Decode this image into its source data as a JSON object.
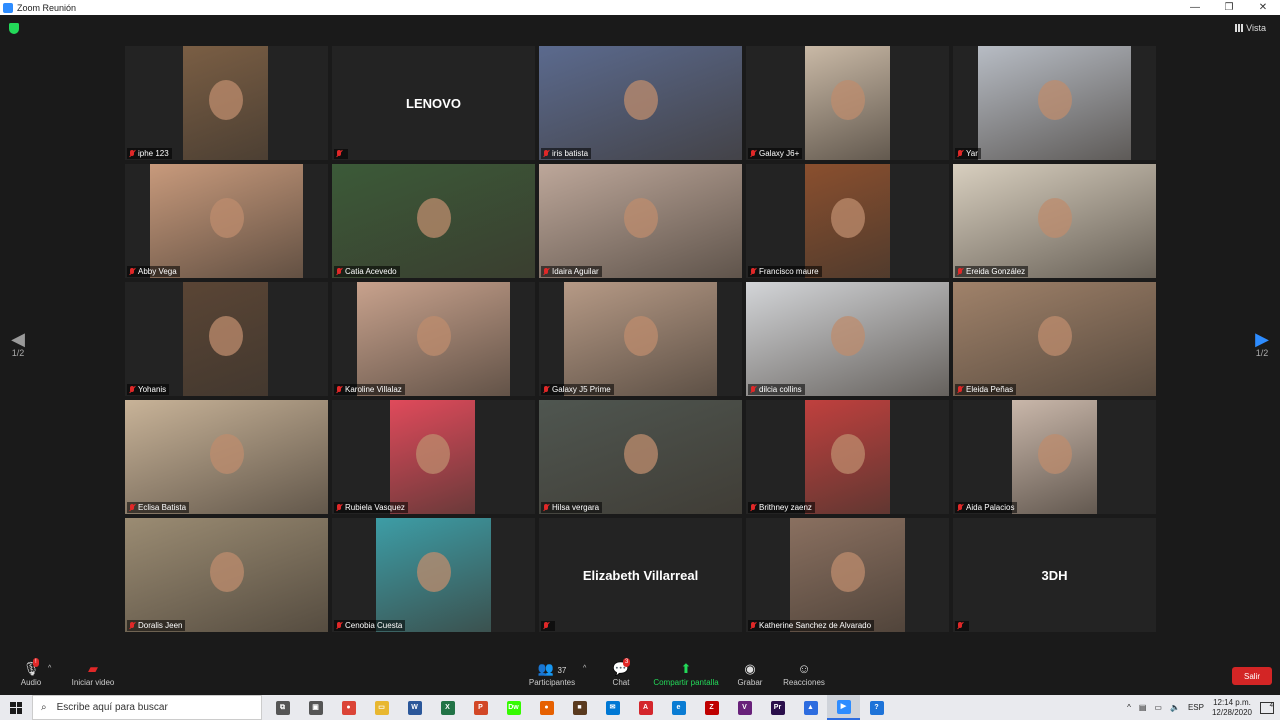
{
  "window": {
    "title": "Zoom Reunión",
    "controls": [
      "—",
      "❐",
      "✕"
    ]
  },
  "header": {
    "view_label": "Vista"
  },
  "pagination": {
    "left": "1/2",
    "right": "1/2"
  },
  "participants": [
    {
      "name": "iphe 123",
      "video": true,
      "bg": "#7a5e44",
      "w": 85,
      "x": 58
    },
    {
      "name": "",
      "video": false,
      "display_name": "LENOVO"
    },
    {
      "name": "iris batista",
      "video": true,
      "bg": "#5b6a8e",
      "w": 203,
      "x": 0
    },
    {
      "name": "Galaxy J6+",
      "video": true,
      "bg": "#c9b9a6",
      "w": 85,
      "x": 59
    },
    {
      "name": "Yar",
      "video": true,
      "bg": "#b7bcc4",
      "w": 153,
      "x": 25
    },
    {
      "name": "Abby Vega",
      "video": true,
      "bg": "#c89a7c",
      "w": 153,
      "x": 25
    },
    {
      "name": "Catia Acevedo",
      "video": true,
      "bg": "#3b5a38",
      "w": 203,
      "x": 0
    },
    {
      "name": "Idaira Aguilar",
      "video": true,
      "bg": "#bda79a",
      "w": 203,
      "x": 0
    },
    {
      "name": "Francisco maure",
      "video": true,
      "bg": "#8a4f2e",
      "w": 85,
      "x": 59
    },
    {
      "name": "Ereida González",
      "video": true,
      "bg": "#d8cfbf",
      "w": 203,
      "x": 0
    },
    {
      "name": "Yohanis",
      "video": true,
      "bg": "#5a4535",
      "w": 85,
      "x": 58
    },
    {
      "name": "Karoline Villalaz",
      "video": true,
      "bg": "#c8a28d",
      "w": 153,
      "x": 25
    },
    {
      "name": "Galaxy J5 Prime",
      "video": true,
      "bg": "#b69a86",
      "w": 153,
      "x": 25
    },
    {
      "name": "dilcia collins",
      "video": true,
      "bg": "#d3d5d8",
      "w": 203,
      "x": 0
    },
    {
      "name": "Eleida Peñas",
      "video": true,
      "bg": "#a0826a",
      "w": 203,
      "x": 0
    },
    {
      "name": "Eclisa Batista",
      "video": true,
      "bg": "#c8b398",
      "w": 203,
      "x": 0
    },
    {
      "name": "Rubiela Vasquez",
      "video": true,
      "bg": "#e04a5b",
      "w": 85,
      "x": 58
    },
    {
      "name": "Hilsa vergara",
      "video": true,
      "bg": "#4f5650",
      "w": 203,
      "x": 0
    },
    {
      "name": "Brithney zaenz",
      "video": true,
      "bg": "#c0403e",
      "w": 85,
      "x": 59
    },
    {
      "name": "Aida Palacios",
      "video": true,
      "bg": "#c9b7aa",
      "w": 85,
      "x": 59
    },
    {
      "name": "Doralis Jeen",
      "video": true,
      "bg": "#9b8c73",
      "w": 203,
      "x": 0
    },
    {
      "name": "Cenobia Cuesta",
      "video": true,
      "bg": "#3d9da6",
      "w": 115,
      "x": 44
    },
    {
      "name": "",
      "video": false,
      "display_name": "Elizabeth Villarreal"
    },
    {
      "name": "Katherine Sanchez de Alvarado",
      "video": true,
      "bg": "#8a7060",
      "w": 115,
      "x": 44
    },
    {
      "name": "",
      "video": false,
      "display_name": "3DH"
    }
  ],
  "toolbar": {
    "audio_label": "Audio",
    "audio_badge": "!",
    "video_label": "Iniciar video",
    "participants_label": "Participantes",
    "participants_count": "37",
    "chat_label": "Chat",
    "chat_badge": "3",
    "share_label": "Compartir pantalla",
    "record_label": "Grabar",
    "reactions_label": "Reacciones",
    "leave_label": "Salir"
  },
  "taskbar": {
    "search_placeholder": "Escribe aquí para buscar",
    "apps": [
      {
        "name": "task-view",
        "color": "#555555",
        "glyph": "⧉"
      },
      {
        "name": "store",
        "color": "#555555",
        "glyph": "▣"
      },
      {
        "name": "chrome",
        "color": "#db4437",
        "glyph": "●"
      },
      {
        "name": "file-explorer",
        "color": "#e8b730",
        "glyph": "▭"
      },
      {
        "name": "word",
        "color": "#2b579a",
        "glyph": "W"
      },
      {
        "name": "excel",
        "color": "#217346",
        "glyph": "X"
      },
      {
        "name": "powerpoint",
        "color": "#d24726",
        "glyph": "P"
      },
      {
        "name": "dreamweaver",
        "color": "#35fa00",
        "glyph": "Dw"
      },
      {
        "name": "firefox",
        "color": "#e66000",
        "glyph": "●"
      },
      {
        "name": "app-dark",
        "color": "#5a3a1e",
        "glyph": "■"
      },
      {
        "name": "mail",
        "color": "#0078d4",
        "glyph": "✉"
      },
      {
        "name": "acrobat",
        "color": "#d4262c",
        "glyph": "A"
      },
      {
        "name": "edge",
        "color": "#0a7cd3",
        "glyph": "e"
      },
      {
        "name": "filezilla",
        "color": "#bf0000",
        "glyph": "Z"
      },
      {
        "name": "visual-studio",
        "color": "#68217a",
        "glyph": "V"
      },
      {
        "name": "premiere",
        "color": "#2a0f4b",
        "glyph": "Pr"
      },
      {
        "name": "app-blue",
        "color": "#2d6cdf",
        "glyph": "▲"
      },
      {
        "name": "zoom",
        "color": "#2d8cff",
        "glyph": "▶"
      },
      {
        "name": "help",
        "color": "#1e73d8",
        "glyph": "?"
      }
    ],
    "language": "ESP",
    "time": "12:14 p.m.",
    "date": "12/28/2020",
    "notifications": "4"
  }
}
